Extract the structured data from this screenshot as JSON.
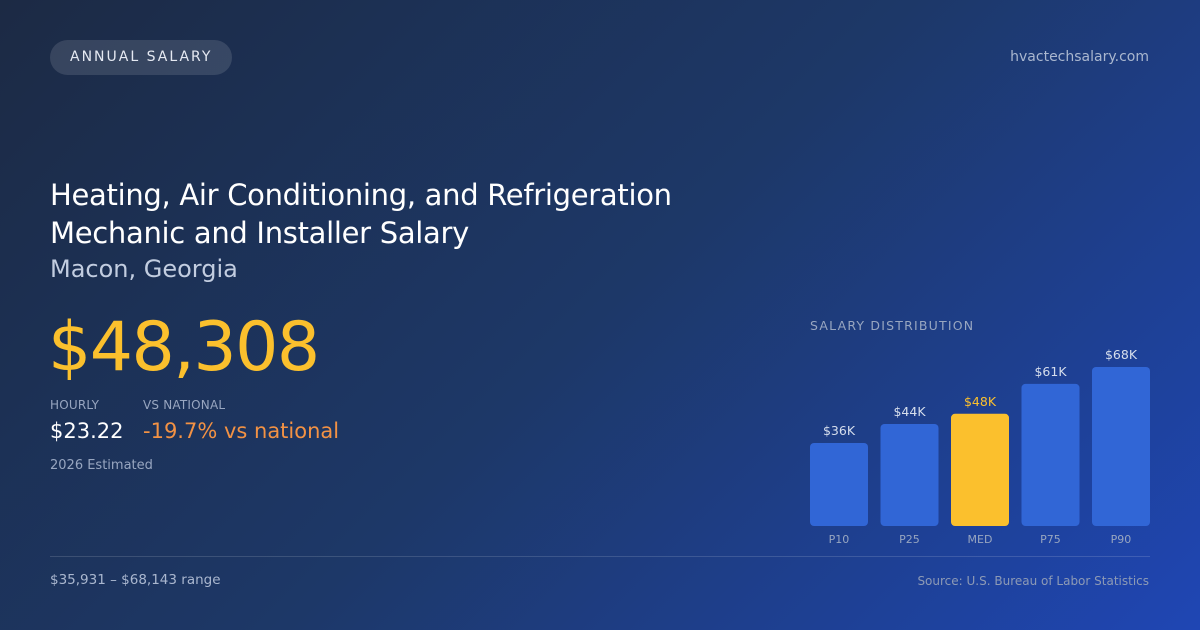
{
  "header": {
    "badge": "ANNUAL SALARY",
    "site": "hvactechsalary.com"
  },
  "hero": {
    "title": "Heating, Air Conditioning, and Refrigeration Mechanic and Installer Salary",
    "location": "Macon, Georgia",
    "salary": "$48,308",
    "hourly_label": "HOURLY",
    "hourly_value": "$23.22",
    "vs_label": "VS NATIONAL",
    "vs_value": "-19.7% vs national",
    "estimate": "2026 Estimated"
  },
  "footer": {
    "range": "$35,931 – $68,143 range",
    "source": "Source: U.S. Bureau of Labor Statistics"
  },
  "colors": {
    "accent": "#fbc02d",
    "bar": "#3166d6",
    "negative": "#f39244"
  },
  "chart_data": {
    "type": "bar",
    "title": "SALARY DISTRIBUTION",
    "categories": [
      "P10",
      "P25",
      "MED",
      "P75",
      "P90"
    ],
    "values": [
      35931,
      44000,
      48308,
      61000,
      68143
    ],
    "value_labels": [
      "$36K",
      "$44K",
      "$48K",
      "$61K",
      "$68K"
    ],
    "highlight_index": 2,
    "xlabel": "",
    "ylabel": "",
    "grid": false,
    "legend": "none"
  }
}
